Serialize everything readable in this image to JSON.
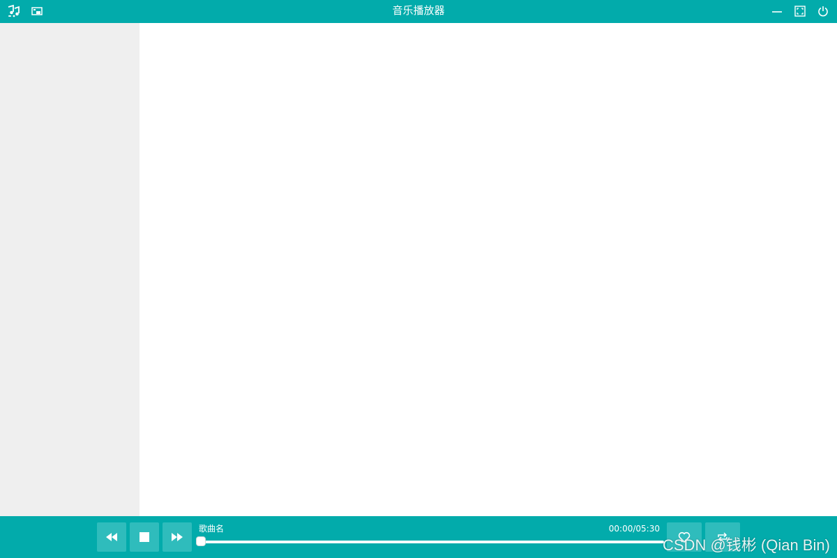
{
  "window": {
    "title": "音乐播放器",
    "accent_color": "#02abab",
    "sidebar_color": "#efefef",
    "left_icons": [
      "music-icon",
      "picture-in-picture-icon"
    ],
    "right_icons": [
      "minimize-icon",
      "fullscreen-icon",
      "power-icon"
    ]
  },
  "player": {
    "song_name": "歌曲名",
    "time": "00:00/05:30",
    "progress_fraction": 0.0,
    "buttons": [
      "rewind-icon",
      "stop-icon",
      "fast-forward-icon",
      "heart-icon",
      "repeat-icon"
    ]
  },
  "watermark": "CSDN @钱彬 (Qian Bin)"
}
